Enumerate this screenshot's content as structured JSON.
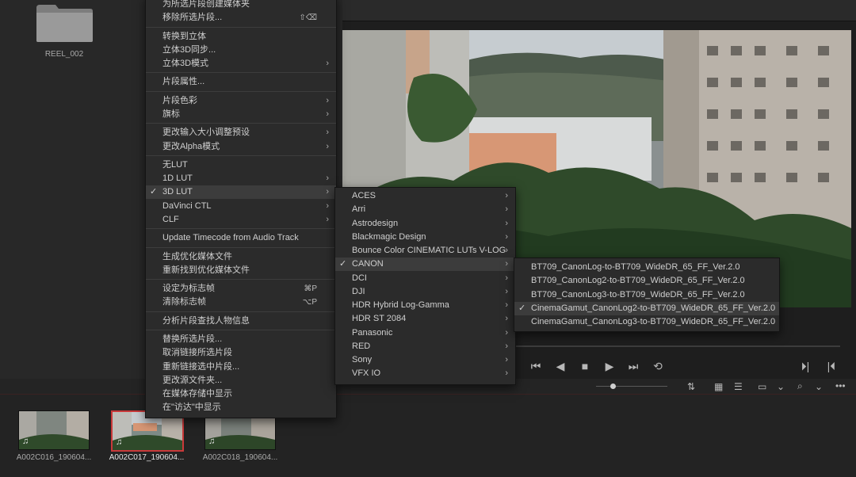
{
  "media_pool": {
    "folder_label": "REEL_002"
  },
  "clips": [
    {
      "label": "A002C016_190604...",
      "selected": false
    },
    {
      "label": "A002C017_190604...",
      "selected": true
    },
    {
      "label": "A002C018_190604...",
      "selected": false
    }
  ],
  "context_menu": [
    {
      "label": "为所选片段创建媒体夹"
    },
    {
      "label": "移除所选片段...",
      "shortcut": "⇧⌫"
    },
    {
      "sep": true
    },
    {
      "label": "转换到立体"
    },
    {
      "label": "立体3D同步..."
    },
    {
      "label": "立体3D模式",
      "arrow": "›"
    },
    {
      "sep": true
    },
    {
      "label": "片段属性..."
    },
    {
      "sep": true
    },
    {
      "label": "片段色彩",
      "arrow": "›"
    },
    {
      "label": "旗标",
      "arrow": "›"
    },
    {
      "sep": true
    },
    {
      "label": "更改输入大小调整预设",
      "arrow": "›"
    },
    {
      "label": "更改Alpha模式",
      "arrow": "›"
    },
    {
      "sep": true
    },
    {
      "label": "无LUT"
    },
    {
      "label": "1D LUT",
      "arrow": "›"
    },
    {
      "label": "3D LUT",
      "arrow": "›",
      "check": "✓",
      "highlight": true
    },
    {
      "label": "DaVinci CTL",
      "arrow": "›"
    },
    {
      "label": "CLF",
      "arrow": "›"
    },
    {
      "sep": true
    },
    {
      "label": "Update Timecode from Audio Track"
    },
    {
      "sep": true
    },
    {
      "label": "生成优化媒体文件"
    },
    {
      "label": "重新找到优化媒体文件"
    },
    {
      "sep": true
    },
    {
      "label": "设定为标志帧",
      "shortcut": "⌘P"
    },
    {
      "label": "清除标志帧",
      "shortcut": "⌥P"
    },
    {
      "sep": true
    },
    {
      "label": "分析片段查找人物信息"
    },
    {
      "sep": true
    },
    {
      "label": "替换所选片段..."
    },
    {
      "label": "取消链接所选片段"
    },
    {
      "label": "重新链接选中片段..."
    },
    {
      "label": "更改源文件夹..."
    },
    {
      "label": "在媒体存储中显示"
    },
    {
      "label": "在\"访达\"中显示"
    }
  ],
  "lut_submenu": [
    {
      "label": "ACES",
      "arrow": "›"
    },
    {
      "label": "Arri",
      "arrow": "›"
    },
    {
      "label": "Astrodesign",
      "arrow": "›"
    },
    {
      "label": "Blackmagic Design",
      "arrow": "›"
    },
    {
      "label": "Bounce Color CINEMATIC LUTs V-LOG",
      "arrow": "›"
    },
    {
      "label": "CANON",
      "arrow": "›",
      "check": "✓",
      "highlight": true
    },
    {
      "label": "DCI",
      "arrow": "›"
    },
    {
      "label": "DJI",
      "arrow": "›"
    },
    {
      "label": "HDR Hybrid Log-Gamma",
      "arrow": "›"
    },
    {
      "label": "HDR ST 2084",
      "arrow": "›"
    },
    {
      "label": "Panasonic",
      "arrow": "›"
    },
    {
      "label": "RED",
      "arrow": "›"
    },
    {
      "label": "Sony",
      "arrow": "›"
    },
    {
      "label": "VFX IO",
      "arrow": "›"
    }
  ],
  "canon_submenu": [
    {
      "label": "BT709_CanonLog-to-BT709_WideDR_65_FF_Ver.2.0"
    },
    {
      "label": "BT709_CanonLog2-to-BT709_WideDR_65_FF_Ver.2.0"
    },
    {
      "label": "BT709_CanonLog3-to-BT709_WideDR_65_FF_Ver.2.0"
    },
    {
      "label": "CinemaGamut_CanonLog2-to-BT709_WideDR_65_FF_Ver.2.0",
      "check": "✓",
      "highlight": true
    },
    {
      "label": "CinemaGamut_CanonLog3-to-BT709_WideDR_65_FF_Ver.2.0"
    }
  ],
  "transport": {
    "icons": [
      "skip-back-icon",
      "step-back-icon",
      "stop-icon",
      "play-icon",
      "skip-forward-icon",
      "loop-icon"
    ]
  },
  "toolbar_icons": [
    "sort-icon",
    "grid-view-icon",
    "list-view-icon",
    "viewer-mode-icon",
    "search-icon",
    "more-options-icon"
  ],
  "colors": {
    "menu_bg": "#2b2b2b",
    "highlight": "#3c3c3c",
    "selected_clip_border": "#c9393a"
  }
}
